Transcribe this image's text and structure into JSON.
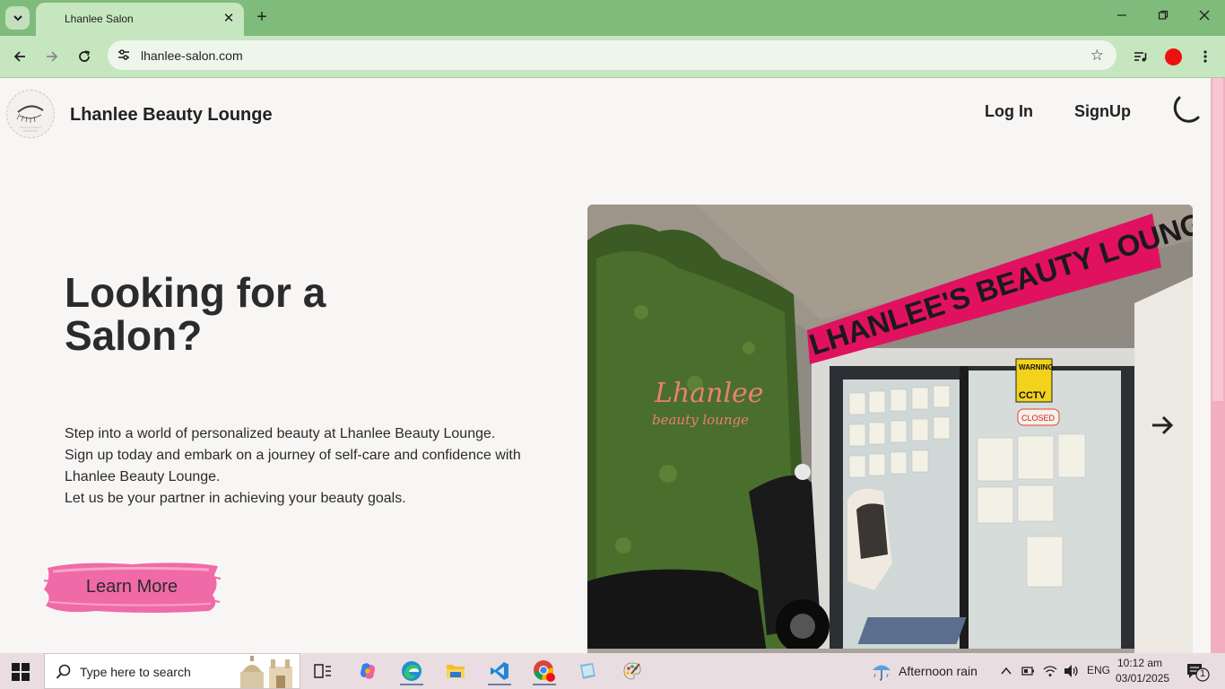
{
  "browser": {
    "tab_title": "Lhanlee Salon",
    "url": "lhanlee-salon.com",
    "new_tab": "+",
    "close_tab": "✕"
  },
  "site": {
    "brand": "Lhanlee Beauty Lounge",
    "nav": {
      "login": "Log In",
      "signup": "SignUp"
    }
  },
  "hero": {
    "title": "Looking for a Salon?",
    "paragraphs": [
      "Step into a world of personalized beauty at Lhanlee Beauty Lounge.",
      "Sign up today and embark on a journey of self-care and confidence with Lhanlee Beauty Lounge.",
      "Let us be your partner in achieving your beauty goals."
    ],
    "cta": "Learn More"
  },
  "photo": {
    "sign_text": "LHANLEE'S BEAUTY LOUNGE",
    "wall_script_1": "Lhanlee",
    "wall_script_2": "beauty lounge",
    "warning": "WARNING",
    "cctv": "CCTV",
    "closed": "CLOSED"
  },
  "taskbar": {
    "search_placeholder": "Type here to search",
    "weather": "Afternoon rain",
    "language": "ENG",
    "time": "10:12 am",
    "date": "03/01/2025",
    "notif_count": "1"
  },
  "colors": {
    "tabbar": "#7fbb7a",
    "toolbar": "#c6e6c0",
    "page_bg": "#f8f6f4",
    "brand_pink": "#f06aa8",
    "scrollbar": "#f2aebf"
  }
}
